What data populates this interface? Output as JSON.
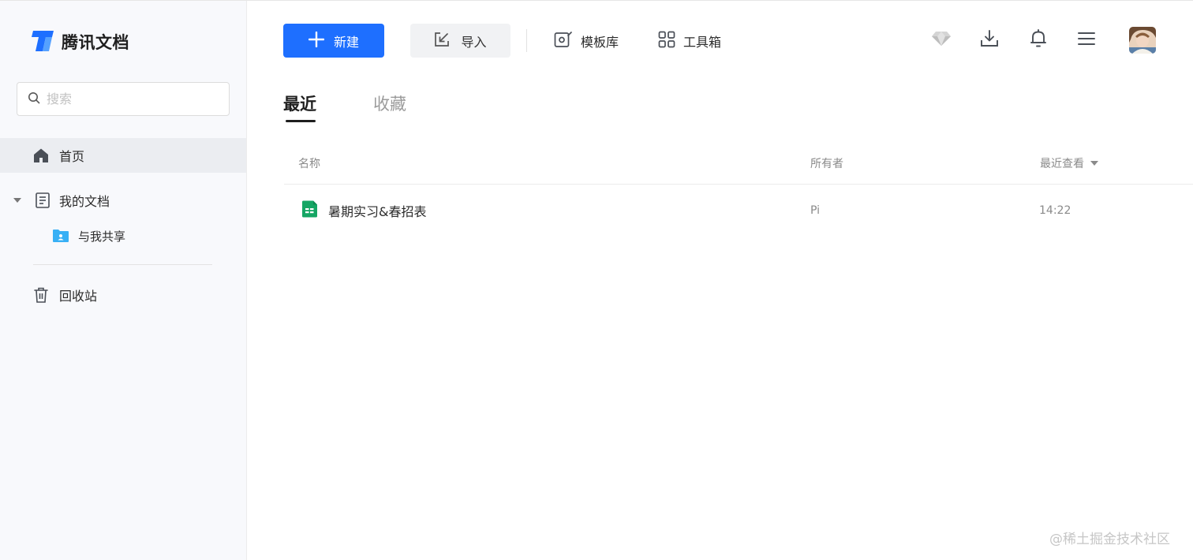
{
  "app": {
    "name": "腾讯文档",
    "colors": {
      "primary": "#1e6fff",
      "sheet_green": "#15a664",
      "folder_blue": "#38b0f5"
    }
  },
  "sidebar": {
    "search_placeholder": "搜索",
    "items": [
      {
        "label": "首页",
        "icon": "home-icon",
        "active": true
      },
      {
        "label": "我的文档",
        "icon": "document-icon",
        "expanded": true
      },
      {
        "label": "与我共享",
        "icon": "shared-folder-icon"
      },
      {
        "label": "回收站",
        "icon": "trash-icon"
      }
    ]
  },
  "toolbar": {
    "new_label": "新建",
    "import_label": "导入",
    "templates_label": "模板库",
    "tools_label": "工具箱",
    "icons": [
      "diamond-icon",
      "download-icon",
      "bell-icon",
      "menu-icon"
    ]
  },
  "tabs": [
    {
      "label": "最近",
      "active": true
    },
    {
      "label": "收藏",
      "active": false
    }
  ],
  "table": {
    "columns": [
      "名称",
      "所有者",
      "最近查看"
    ],
    "rows": [
      {
        "name": "暑期实习&春招表",
        "owner": "Pi",
        "last_viewed": "14:22",
        "icon": "spreadsheet-icon"
      }
    ]
  },
  "watermark": "@稀土掘金技术社区"
}
